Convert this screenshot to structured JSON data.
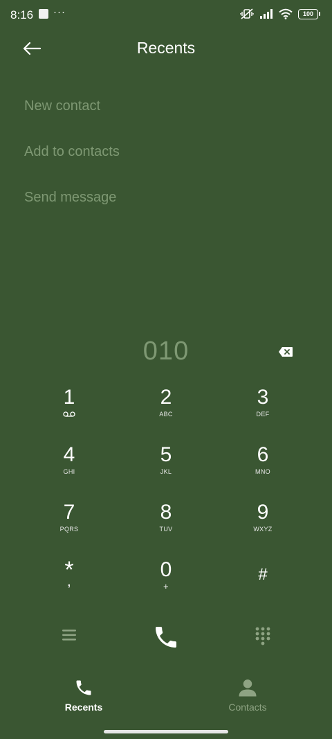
{
  "status_bar": {
    "time": "8:16",
    "more": "···",
    "battery": "100"
  },
  "header": {
    "title": "Recents",
    "back_icon": "arrow-left-icon"
  },
  "options": [
    {
      "label": "New contact"
    },
    {
      "label": "Add to contacts"
    },
    {
      "label": "Send message"
    }
  ],
  "dialer": {
    "number": "010",
    "keys": [
      {
        "digit": "1",
        "letters": ""
      },
      {
        "digit": "2",
        "letters": "ABC"
      },
      {
        "digit": "3",
        "letters": "DEF"
      },
      {
        "digit": "4",
        "letters": "GHI"
      },
      {
        "digit": "5",
        "letters": "JKL"
      },
      {
        "digit": "6",
        "letters": "MNO"
      },
      {
        "digit": "7",
        "letters": "PQRS"
      },
      {
        "digit": "8",
        "letters": "TUV"
      },
      {
        "digit": "9",
        "letters": "WXYZ"
      },
      {
        "digit": "*",
        "letters": ","
      },
      {
        "digit": "0",
        "letters": "+"
      },
      {
        "digit": "#",
        "letters": ""
      }
    ]
  },
  "bottom_nav": {
    "tabs": [
      {
        "label": "Recents",
        "icon": "phone-icon",
        "active": true
      },
      {
        "label": "Contacts",
        "icon": "person-icon",
        "active": false
      }
    ]
  },
  "colors": {
    "background": "#3a5632",
    "muted_text": "#7e9873",
    "inactive_nav": "#8ea383"
  }
}
